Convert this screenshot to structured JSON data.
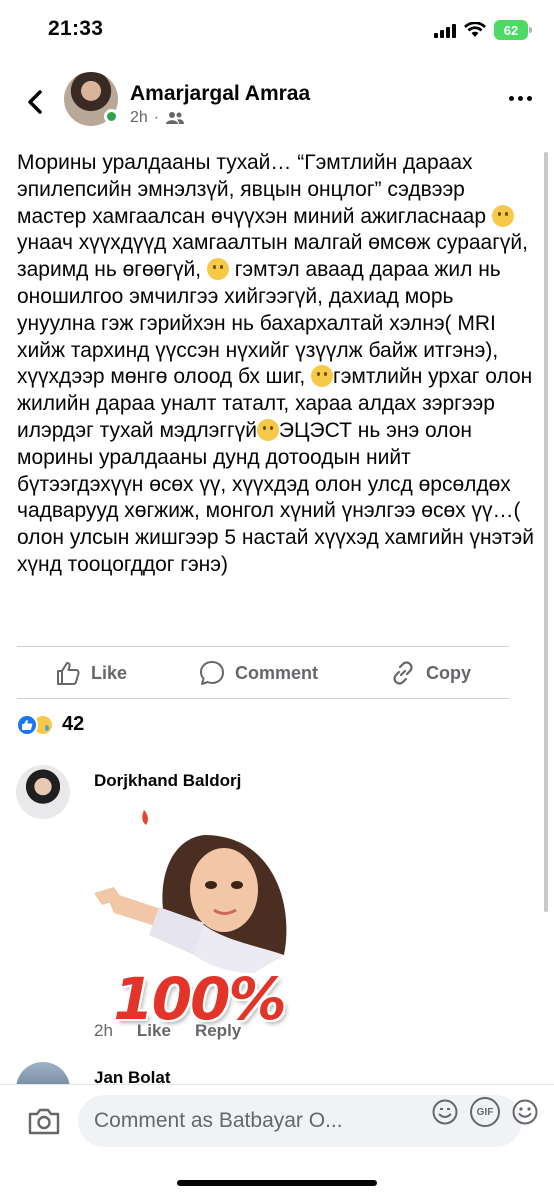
{
  "status": {
    "time": "21:33",
    "battery": "62"
  },
  "header": {
    "author": "Amarjargal Amraa",
    "time": "2h",
    "separator": "·",
    "icons": {
      "back": "back-chevron-icon",
      "audience": "friends-icon",
      "more": "more-dots-icon"
    }
  },
  "post": {
    "segments": {
      "s1": "Морины уралдааны тухай… “Гэмтлийн дараах эпилепсийн эмнэлзүй, явцын онцлог” сэдвээр мастер хамгаалсан өчүүхэн миний ажигласнаар ",
      "s2": "унаач хүүхдүүд хамгаалтын  малгай өмсөж сураагүй, заримд нь өгөөгүй, ",
      "s3": " гэмтэл аваад дараа жил нь оношилгоо эмчилгээ хийгээгүй, дахиад морь унуулна гэж гэрийхэн нь бахархалтай хэлнэ( MRI хийж тархинд үүссэн нүхийг үзүүлж байж итгэнэ), хүүхдээр мөнгө олоод бх шиг, ",
      "s4": "гэмтлийн урхаг олон жилийн дараа уналт таталт, хараа алдах зэргээр илэрдэг тухай мэдлэггүй",
      "s5": "ЭЦЭСТ нь энэ олон морины уралдааны дунд дотоодын нийт бүтээгдэхүүн өсөх үү, хүүхдэд олон улсд өрсөлдөх чадварууд хөгжиж, монгол хүний үнэлгээ өсөх үү…( олон улсын жишгээр 5 настай хүүхэд хамгийн үнэтэй хүнд тооцогддог гэнэ)"
    },
    "emoji": [
      "slightly-frowning-emoji",
      "crying-emoji",
      "pleading-emoji",
      "upside-down-emoji"
    ]
  },
  "actions": {
    "like": "Like",
    "comment": "Comment",
    "copy": "Copy"
  },
  "reactions": {
    "count": "42",
    "types": [
      "like",
      "sad"
    ]
  },
  "comments": [
    {
      "name": "Dorjkhand Baldorj",
      "sticker_text": "100%",
      "time": "2h",
      "like": "Like",
      "reply": "Reply"
    },
    {
      "name": "Jan Bolat"
    }
  ],
  "composer": {
    "placeholder": "Comment as Batbayar O..."
  },
  "colors": {
    "brand_blue": "#1877f2",
    "online_green": "#31a24c",
    "secondary_text": "#65676b",
    "battery_green": "#4cd964"
  }
}
